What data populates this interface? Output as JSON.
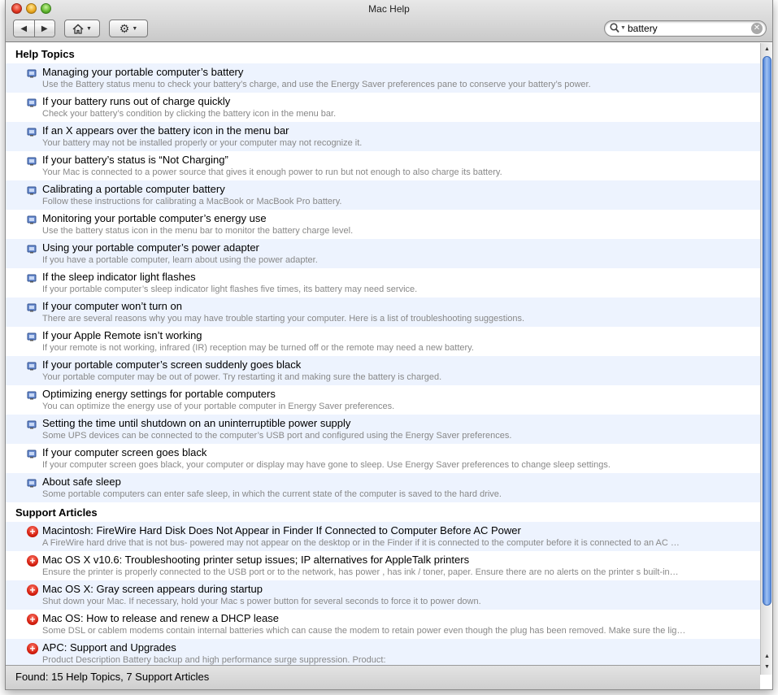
{
  "window": {
    "title": "Mac Help"
  },
  "toolbar": {
    "back_icon": "back-arrow-icon",
    "forward_icon": "forward-arrow-icon",
    "home_icon": "home-icon",
    "action_icon": "gear-icon"
  },
  "search": {
    "value": "battery",
    "icon": "search-icon"
  },
  "help_topics": {
    "heading": "Help Topics",
    "items": [
      {
        "title": "Managing your portable computer’s battery",
        "desc": "Use the Battery status menu to check your battery’s charge, and use the Energy Saver preferences pane to conserve your battery’s power."
      },
      {
        "title": "If your battery runs out of charge quickly",
        "desc": "Check your battery’s condition by clicking the battery icon in the menu bar."
      },
      {
        "title": "If an X appears over the battery icon in the menu bar",
        "desc": "Your battery may not be installed properly or your computer may not recognize it."
      },
      {
        "title": "If your battery’s status is “Not Charging”",
        "desc": "Your Mac is connected to a power source that gives it enough power to run but not enough to also charge its battery."
      },
      {
        "title": "Calibrating a portable computer battery",
        "desc": "Follow these instructions for calibrating a MacBook or MacBook Pro battery."
      },
      {
        "title": "Monitoring your portable computer’s energy use",
        "desc": "Use the battery status icon in the menu bar to monitor the battery charge level."
      },
      {
        "title": "Using your portable computer’s power adapter",
        "desc": "If you have a portable computer, learn about using the power adapter."
      },
      {
        "title": "If the sleep indicator light flashes",
        "desc": "If your portable computer’s sleep indicator light flashes five times, its battery may need service."
      },
      {
        "title": "If your computer won’t turn on",
        "desc": "There are several reasons why you may have trouble starting your computer. Here is a list of troubleshooting suggestions."
      },
      {
        "title": "If your Apple Remote isn’t working",
        "desc": "If your remote is not working, infrared (IR) reception may be turned off or the remote may need a new battery."
      },
      {
        "title": "If your portable computer’s screen suddenly goes black",
        "desc": "Your portable computer may be out of power. Try restarting it and making sure the battery is charged."
      },
      {
        "title": "Optimizing energy settings for portable computers",
        "desc": "You can optimize the energy use of your portable computer in Energy Saver preferences."
      },
      {
        "title": "Setting the time until shutdown on an uninterruptible power supply",
        "desc": "Some UPS devices can be connected to the computer’s USB port and configured using the Energy Saver preferences."
      },
      {
        "title": "If your computer screen goes black",
        "desc": "If your computer screen goes black, your computer or display may have gone to sleep. Use Energy Saver preferences to change sleep settings."
      },
      {
        "title": "About safe sleep",
        "desc": "Some portable computers can enter safe sleep, in which the current state of the computer is saved to the hard drive."
      }
    ]
  },
  "support_articles": {
    "heading": "Support Articles",
    "items": [
      {
        "title": "Macintosh: FireWire Hard Disk Does Not Appear in Finder If Connected to Computer Before AC Power",
        "desc": "A FireWire hard drive that is not bus- powered may not appear on the desktop or in the Finder if it is connected to the computer before it is connected to an AC …"
      },
      {
        "title": "Mac OS X v10.6: Troubleshooting printer setup issues; IP alternatives for AppleTalk printers",
        "desc": "Ensure the printer is properly connected to the USB port or to the network, has power , has ink / toner, paper. Ensure there are no alerts on the printer s built-in…"
      },
      {
        "title": "Mac OS X: Gray screen appears during startup",
        "desc": "Shut down your Mac. If necessary, hold your Mac s power button for several seconds to force it to power down."
      },
      {
        "title": "Mac OS: How to release and renew a DHCP lease",
        "desc": "Some DSL or cablem modems contain internal batteries which can cause the modem to retain power even though the plug has been removed. Make sure the lig…"
      },
      {
        "title": "APC: Support and Upgrades",
        "desc": "Product Description Battery backup and high performance surge suppression. Product:"
      }
    ]
  },
  "status": {
    "text": "Found: 15 Help Topics, 7 Support Articles"
  }
}
